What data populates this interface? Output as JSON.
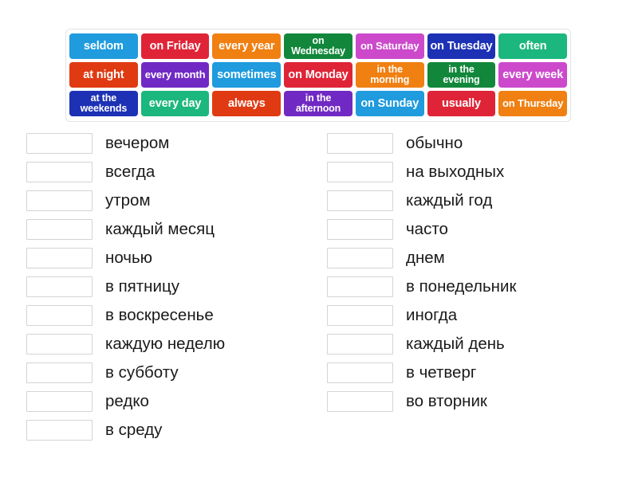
{
  "word_bank": {
    "name": "word-bank",
    "rows": [
      [
        {
          "label": "seldom",
          "color": "#1f9bde",
          "lines": 1
        },
        {
          "label": "on Friday",
          "color": "#e02437",
          "lines": 1
        },
        {
          "label": "every year",
          "color": "#f08012",
          "lines": 1
        },
        {
          "label": "on\nWednesday",
          "color": "#12873b",
          "lines": 2
        },
        {
          "label": "on Saturday",
          "color": "#cc49cc",
          "lines": 1
        },
        {
          "label": "on Tuesday",
          "color": "#1d31b5",
          "lines": 1
        },
        {
          "label": "often",
          "color": "#1cb77e",
          "lines": 1
        }
      ],
      [
        {
          "label": "at night",
          "color": "#e03a12",
          "lines": 1
        },
        {
          "label": "every month",
          "color": "#7129c4",
          "lines": 1
        },
        {
          "label": "sometimes",
          "color": "#1f9bde",
          "lines": 1
        },
        {
          "label": "on Monday",
          "color": "#e02437",
          "lines": 1
        },
        {
          "label": "in the\nmorning",
          "color": "#f08012",
          "lines": 2
        },
        {
          "label": "in the\nevening",
          "color": "#12873b",
          "lines": 2
        },
        {
          "label": "every week",
          "color": "#cc49cc",
          "lines": 1
        }
      ],
      [
        {
          "label": "at the\nweekends",
          "color": "#1d31b5",
          "lines": 2
        },
        {
          "label": "every day",
          "color": "#1cb77e",
          "lines": 1
        },
        {
          "label": "always",
          "color": "#e03a12",
          "lines": 1
        },
        {
          "label": "in the\nafternoon",
          "color": "#7129c4",
          "lines": 2
        },
        {
          "label": "on Sunday",
          "color": "#1f9bde",
          "lines": 1
        },
        {
          "label": "usually",
          "color": "#e02437",
          "lines": 1
        },
        {
          "label": "on Thursday",
          "color": "#f08012",
          "lines": 1
        }
      ]
    ]
  },
  "answers": {
    "left_column": [
      {
        "label": "вечером",
        "value": ""
      },
      {
        "label": "всегда",
        "value": ""
      },
      {
        "label": "утром",
        "value": ""
      },
      {
        "label": "каждый месяц",
        "value": ""
      },
      {
        "label": "ночью",
        "value": ""
      },
      {
        "label": "в пятницу",
        "value": ""
      },
      {
        "label": "в воскресенье",
        "value": ""
      },
      {
        "label": "каждую неделю",
        "value": ""
      },
      {
        "label": "в субботу",
        "value": ""
      },
      {
        "label": "редко",
        "value": ""
      },
      {
        "label": "в среду",
        "value": ""
      }
    ],
    "right_column": [
      {
        "label": "обычно",
        "value": ""
      },
      {
        "label": "на выходных",
        "value": ""
      },
      {
        "label": "каждый год",
        "value": ""
      },
      {
        "label": "часто",
        "value": ""
      },
      {
        "label": "днем",
        "value": ""
      },
      {
        "label": "в понедельник",
        "value": ""
      },
      {
        "label": "иногда",
        "value": ""
      },
      {
        "label": "каждый день",
        "value": ""
      },
      {
        "label": "в четверг",
        "value": ""
      },
      {
        "label": "во вторник",
        "value": ""
      }
    ]
  }
}
